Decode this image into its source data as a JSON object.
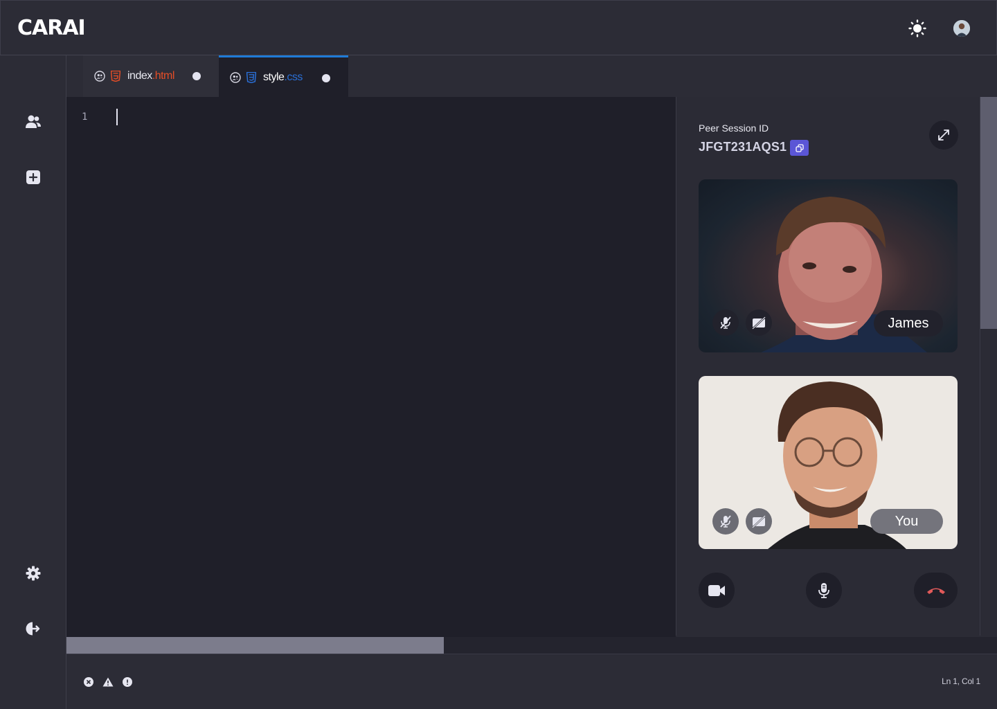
{
  "app": {
    "logo": "CARAI"
  },
  "tabs": [
    {
      "name": "index",
      "ext": ".html"
    },
    {
      "name": "style",
      "ext": ".css"
    }
  ],
  "editor": {
    "line_numbers": [
      "1"
    ]
  },
  "session": {
    "label": "Peer Session ID",
    "id": "JFGT231AQS1"
  },
  "participants": [
    {
      "name": "James"
    },
    {
      "name": "You"
    }
  ],
  "status": {
    "cursor_position": "Ln 1,  Col 1"
  },
  "icons": {
    "theme": "sun-icon",
    "sidebar": [
      "users-icon",
      "plus-square-icon",
      "gear-icon",
      "logout-icon"
    ],
    "status": [
      "error-icon",
      "warning-icon",
      "info-icon"
    ]
  },
  "colors": {
    "accent": "#5b56d6",
    "tab_active_border": "#1f7bd8",
    "html_ext": "#e44d26",
    "css_ext": "#2a6fd6",
    "hangup": "#e25a5a"
  }
}
